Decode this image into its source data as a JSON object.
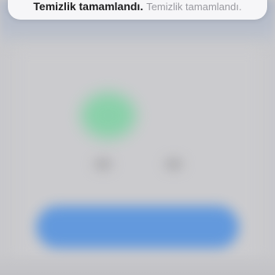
{
  "toast": {
    "title": "Temizlik tamamlandı.",
    "subtitle": "Temizlik tamamlandı."
  },
  "colors": {
    "accent_blurred_button": "#5e97de",
    "success_blob": "#7fd2a4",
    "toast_background": "#f6f6f8"
  }
}
